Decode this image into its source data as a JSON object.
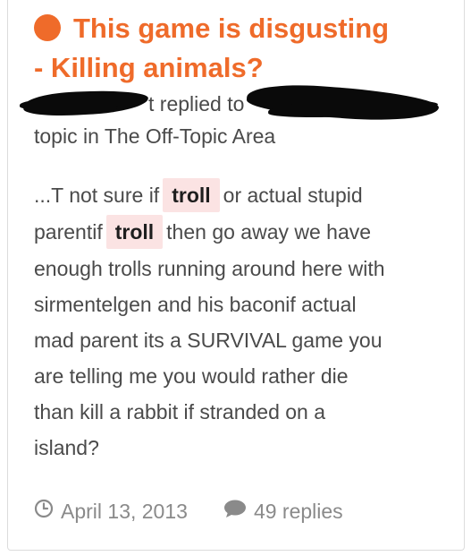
{
  "post": {
    "title_line1": "This game is disgusting",
    "title_line2": "- Killing animals?",
    "meta_line1_suffix": "t replied to",
    "meta_line2": "topic in The Off-Topic Area",
    "body": {
      "l1_a": "...T not sure if",
      "l1_hl": "troll",
      "l1_b": "or actual stupid",
      "l2_a": "parentif",
      "l2_hl": "troll",
      "l2_b": "then go away we have",
      "l3": "enough trolls running around here with",
      "l4": "sirmentelgen and his baconif actual",
      "l5": "mad parent its a SURVIVAL game you",
      "l6": "are telling me you would rather die",
      "l7": "than kill a rabbit if stranded on a",
      "l8": "island?"
    },
    "date": "April 13, 2013",
    "replies": "49 replies"
  },
  "colors": {
    "accent": "#ef6b2a",
    "highlight": "#fbe3e3",
    "text": "#4a4a4a",
    "muted": "#8a8a8a"
  },
  "icons": {
    "status": "orange-dot-icon",
    "date": "clock-icon",
    "replies": "comment-icon"
  }
}
